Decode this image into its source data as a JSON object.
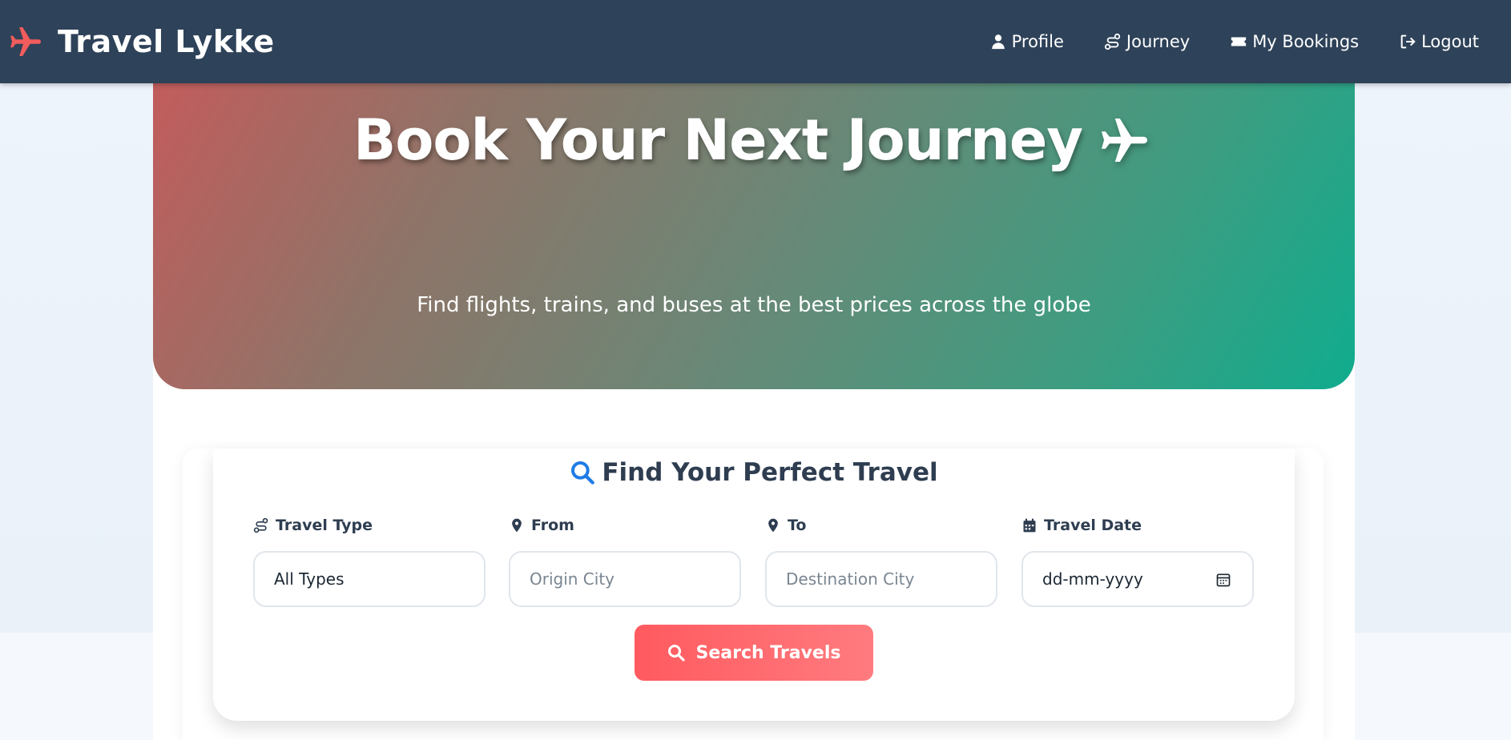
{
  "nav": {
    "brand": "Travel Lykke",
    "brand_icon": "airplane-icon",
    "links": [
      {
        "label": "Profile",
        "icon": "user-icon"
      },
      {
        "label": "Journey",
        "icon": "route-icon"
      },
      {
        "label": "My Bookings",
        "icon": "ticket-icon"
      },
      {
        "label": "Logout",
        "icon": "logout-icon"
      }
    ]
  },
  "hero": {
    "title": "Book Your Next Journey",
    "title_icon": "airplane-icon",
    "subtitle": "Find flights, trains, and buses at the best prices across the globe"
  },
  "search": {
    "title": "Find Your Perfect Travel",
    "fields": [
      {
        "label": "Travel Type",
        "value": "All Types"
      },
      {
        "label": "From",
        "placeholder": "Origin City"
      },
      {
        "label": "To",
        "placeholder": "Destination City"
      },
      {
        "label": "Travel Date",
        "placeholder": "dd-mm-yyyy"
      }
    ],
    "button": "Search Travels"
  },
  "colors": {
    "navbar": "#2e4259",
    "accent_red": "#ff5a5f",
    "accent_teal": "#10ac8e",
    "text_dark": "#2e3d50",
    "search_icon_blue": "#1e7be6"
  }
}
